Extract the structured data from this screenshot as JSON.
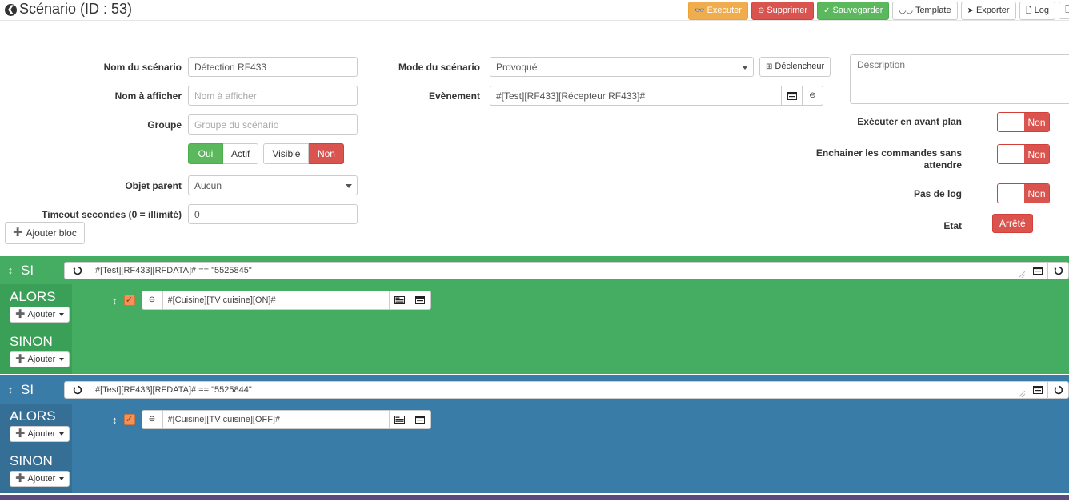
{
  "header": {
    "back_icon": "arrow-left-circle-icon",
    "title": "Scénario (ID : 53)",
    "actions": [
      {
        "label": "Executer",
        "icon": "play-glasses-icon",
        "style": "warning"
      },
      {
        "label": "Supprimer",
        "icon": "minus-circle-icon",
        "style": "danger"
      },
      {
        "label": "Sauvegarder",
        "icon": "check-circle-icon",
        "style": "success"
      },
      {
        "label": "Template",
        "icon": "binoculars-icon",
        "style": "default"
      },
      {
        "label": "Exporter",
        "icon": "share-arrow-icon",
        "style": "default"
      },
      {
        "label": "Log",
        "icon": "file-text-icon",
        "style": "default"
      },
      {
        "label": "",
        "icon": "file-icon",
        "style": "default"
      }
    ]
  },
  "form": {
    "name_label": "Nom du scénario",
    "name_value": "Détection RF433",
    "display_name_label": "Nom à afficher",
    "display_name_placeholder": "Nom à afficher",
    "display_name_value": "",
    "group_label": "Groupe",
    "group_placeholder": "Groupe du scénario",
    "group_value": "",
    "toggles": [
      {
        "label": "Oui",
        "state": "active-green"
      },
      {
        "label": "Actif",
        "state": "inactive"
      },
      {
        "label": "Visible",
        "state": "inactive"
      },
      {
        "label": "Non",
        "state": "active-red"
      }
    ],
    "parent_label": "Objet parent",
    "parent_value": "Aucun",
    "timeout_label": "Timeout secondes (0 = illimité)",
    "timeout_value": "0",
    "mode_label": "Mode du scénario",
    "mode_value": "Provoqué",
    "trigger_button": "Déclencheur",
    "trigger_button_icon": "plus-square-icon",
    "event_label": "Evènement",
    "event_value": "#[Test][RF433][Récepteur RF433]#",
    "event_btn1_icon": "window-icon",
    "event_btn2_icon": "minus-circle-icon",
    "description_placeholder": "Description",
    "description_value": "",
    "right_options": [
      {
        "label": "Exécuter en avant plan",
        "value": "Non"
      },
      {
        "label": "Enchainer les commandes sans attendre",
        "value": "Non"
      },
      {
        "label": "Pas de log",
        "value": "Non"
      }
    ],
    "state_label": "Etat",
    "state_value": "Arrêté"
  },
  "add_block": {
    "label": "Ajouter bloc",
    "icon": "plus-circle-icon"
  },
  "blocks": [
    {
      "color": "blk-green",
      "si_label": "SI",
      "drag_icon": "drag-vertical-icon",
      "refresh_icon": "refresh-icon",
      "condition": "#[Test][RF433][RFDATA]# == \"5525845\"",
      "right_buttons": [
        "window-icon",
        "refresh-icon"
      ],
      "then": {
        "title": "ALORS",
        "add_label": "Ajouter",
        "add_icon": "plus-circle-icon",
        "actions": [
          {
            "drag_icon": "drag-vertical-icon",
            "checked": true,
            "minus_icon": "minus-circle-icon",
            "value": "#[Cuisine][TV cuisine][ON]#",
            "btn1_icon": "list-icon",
            "btn2_icon": "window-icon"
          }
        ]
      },
      "else": {
        "title": "SINON",
        "add_label": "Ajouter",
        "add_icon": "plus-circle-icon",
        "actions": []
      }
    },
    {
      "color": "blk-blue",
      "si_label": "SI",
      "drag_icon": "drag-vertical-icon",
      "refresh_icon": "refresh-icon",
      "condition": "#[Test][RF433][RFDATA]# == \"5525844\"",
      "right_buttons": [
        "window-icon",
        "refresh-icon"
      ],
      "then": {
        "title": "ALORS",
        "add_label": "Ajouter",
        "add_icon": "plus-circle-icon",
        "actions": [
          {
            "drag_icon": "drag-vertical-icon",
            "checked": true,
            "minus_icon": "minus-circle-icon",
            "value": "#[Cuisine][TV cuisine][OFF]#",
            "btn1_icon": "list-icon",
            "btn2_icon": "window-icon"
          }
        ]
      },
      "else": {
        "title": "SINON",
        "add_label": "Ajouter",
        "add_icon": "plus-circle-icon",
        "actions": []
      }
    },
    {
      "color": "blk-purple",
      "si_label": "",
      "partial": true
    }
  ]
}
